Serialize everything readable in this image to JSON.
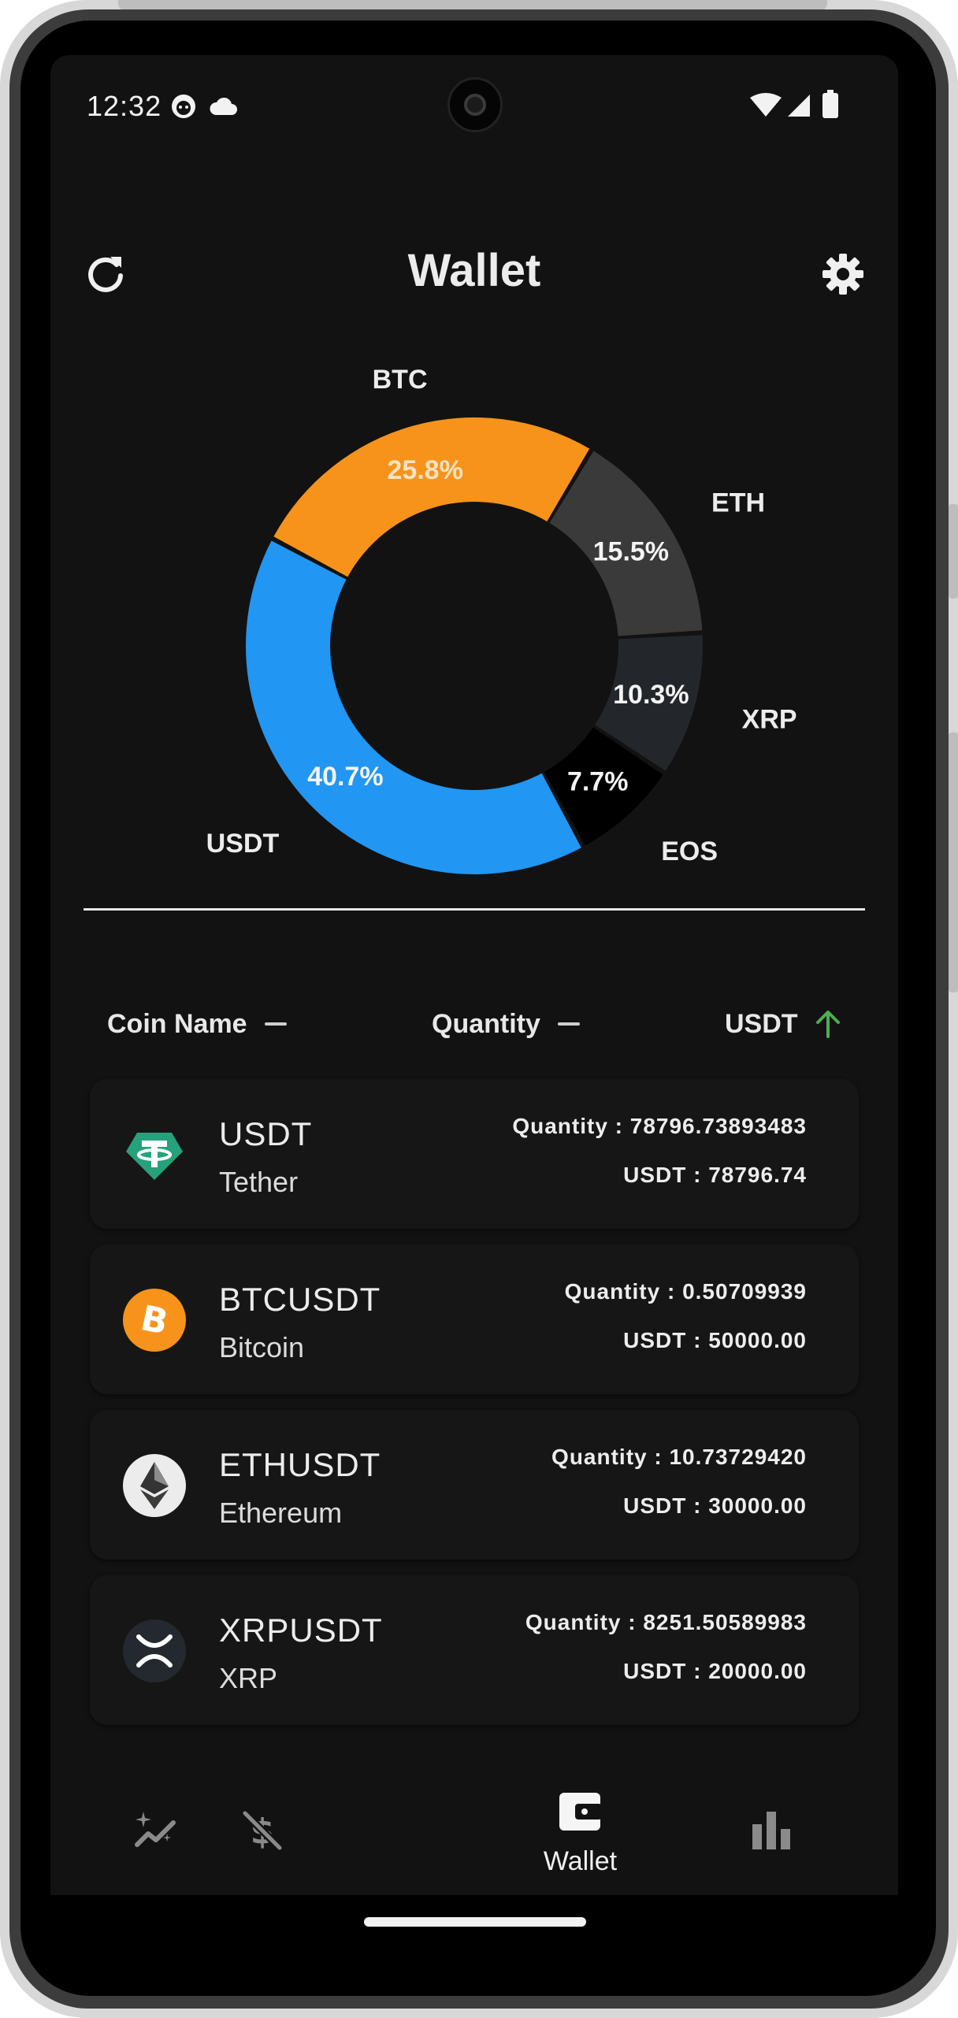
{
  "status_bar": {
    "time": "12:32"
  },
  "app_bar": {
    "title": "Wallet",
    "refresh_icon": "refresh-icon",
    "settings_icon": "gear-icon"
  },
  "chart_data": {
    "type": "pie",
    "title": "",
    "slices": [
      {
        "label": "BTC",
        "value": 25.8,
        "value_label": "25.8%",
        "color": "#F7931A"
      },
      {
        "label": "ETH",
        "value": 15.5,
        "value_label": "15.5%",
        "color": "#3A3A3A"
      },
      {
        "label": "XRP",
        "value": 10.3,
        "value_label": "10.3%",
        "color": "#23272C"
      },
      {
        "label": "EOS",
        "value": 7.7,
        "value_label": "7.7%",
        "color": "#000000"
      },
      {
        "label": "USDT",
        "value": 40.7,
        "value_label": "40.7%",
        "color": "#2196F3"
      }
    ]
  },
  "table": {
    "headers": {
      "coin_name": "Coin Name",
      "quantity": "Quantity",
      "usdt": "USDT"
    },
    "sort_up_color": "#4CAF50"
  },
  "coins": [
    {
      "symbol": "USDT",
      "name": "Tether",
      "quantity": "Quantity : 78796.73893483",
      "usdt": "USDT : 78796.74",
      "icon": "tether-icon"
    },
    {
      "symbol": "BTCUSDT",
      "name": "Bitcoin",
      "quantity": "Quantity : 0.50709939",
      "usdt": "USDT : 50000.00",
      "icon": "bitcoin-icon"
    },
    {
      "symbol": "ETHUSDT",
      "name": "Ethereum",
      "quantity": "Quantity : 10.73729420",
      "usdt": "USDT : 30000.00",
      "icon": "ethereum-icon"
    },
    {
      "symbol": "XRPUSDT",
      "name": "XRP",
      "quantity": "Quantity : 8251.50589983",
      "usdt": "USDT : 20000.00",
      "icon": "xrp-icon"
    }
  ],
  "bottom_nav": {
    "items": [
      {
        "icon": "sparkle-chart-icon",
        "label": ""
      },
      {
        "icon": "no-dollar-icon",
        "label": ""
      },
      {
        "icon": "wallet-icon",
        "label": "Wallet"
      },
      {
        "icon": "bar-chart-icon",
        "label": ""
      }
    ],
    "active_index": 2
  }
}
